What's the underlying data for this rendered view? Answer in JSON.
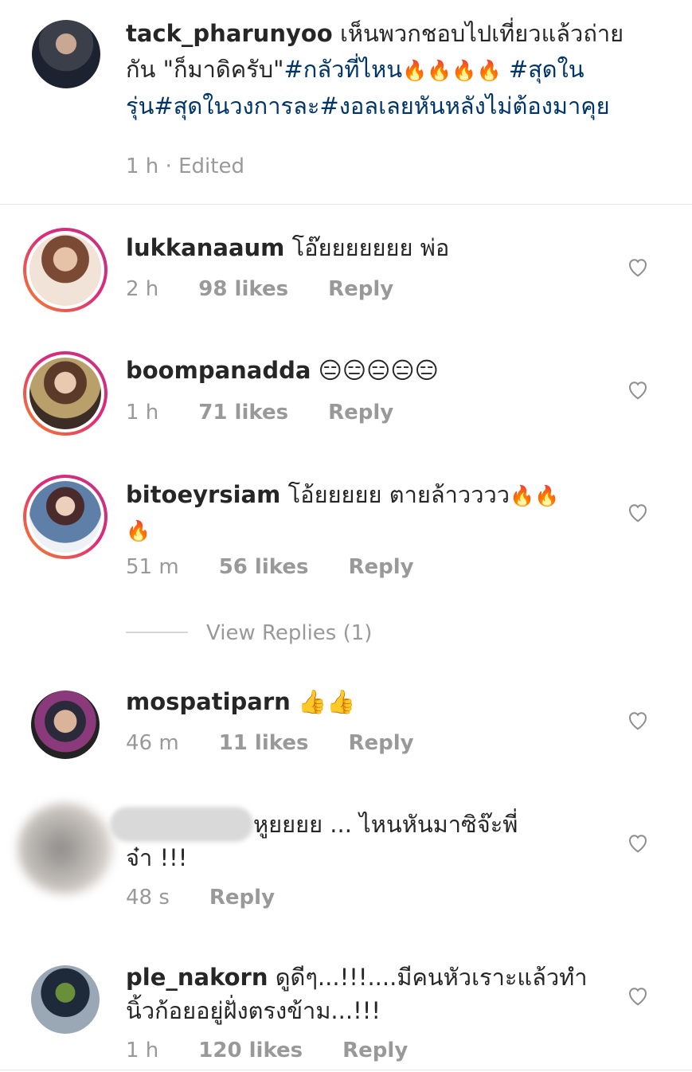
{
  "post": {
    "username": "tack_pharunyoo",
    "caption_text": "เห็นพวกชอบไปเที่ยวแล้วถ่ายกัน \"ก็มาดิครับ\"",
    "hashtags_1": "#กลัวที่ไหน",
    "hashtags_2": "#สุดในรุ่น#สุดในวงการละ#งอลเลยหันหลังไม่ต้องมาคุย",
    "fire": "🔥",
    "time": "1 h",
    "edited": "· Edited"
  },
  "comments": [
    {
      "username": "lukkanaaum",
      "text": "โอ๊ยยยยยยย พ่อ",
      "time": "2 h",
      "likes": "98 likes",
      "reply": "Reply"
    },
    {
      "username": "boompanadda",
      "text": "😑😑😑😑😑",
      "time": "1 h",
      "likes": "71 likes",
      "reply": "Reply"
    },
    {
      "username": "bitoeyrsiam",
      "text": "โอ้ยยยยย ตายล้าวววว",
      "emoji": "🔥",
      "time": "51 m",
      "likes": "56 likes",
      "reply": "Reply",
      "view_replies": "View Replies (1)"
    },
    {
      "username": "mospatiparn",
      "text": "👍👍",
      "time": "46 m",
      "likes": "11 likes",
      "reply": "Reply"
    },
    {
      "text_1": "หูยยยย ... ไหนหันมาซิจ๊ะพี่",
      "text_2": "จ๋า !!!",
      "time": "48 s",
      "reply": "Reply"
    },
    {
      "username": "ple_nakorn",
      "text_1": "ดูดีๆ...!!!....มีคนหัวเราะแล้วทำ",
      "text_2": "นิ้วก้อยอยู่ฝั่งตรงข้าม...!!!",
      "time": "1 h",
      "likes": "120 likes",
      "reply": "Reply"
    }
  ],
  "icons": {
    "heart": "heart-icon"
  },
  "colors": {
    "hashtag": "#003569",
    "muted": "#999999",
    "ring_start": "#f58529",
    "ring_end": "#c13584"
  }
}
